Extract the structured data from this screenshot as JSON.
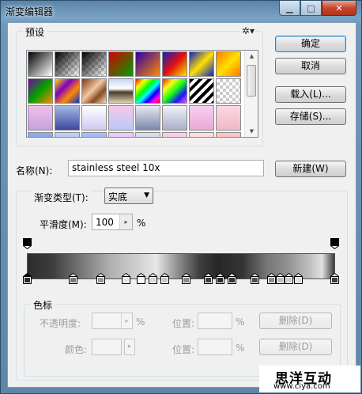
{
  "window": {
    "title": "渐变编辑器",
    "min_glyph": "▁",
    "max_glyph": "□",
    "close_glyph": "✕"
  },
  "presets": {
    "label": "预设",
    "gear_glyph": "✲▾",
    "scroll_up_glyph": "▲",
    "scroll_down_glyph": "▼",
    "swatches": [
      {
        "name": "black-white",
        "css": "linear-gradient(135deg,#000,#fff)"
      },
      {
        "name": "fg-transparent",
        "css": "linear-gradient(135deg,#000 0%,rgba(0,0,0,0) 100%), repeating-conic-gradient(#ccc 0 25%, #fff 0 50%) 0 0/8px 8px"
      },
      {
        "name": "black-transparent",
        "css": "linear-gradient(135deg,#000,rgba(0,0,0,0)), repeating-conic-gradient(#ccc 0 25%, #fff 0 50%) 0 0/8px 8px"
      },
      {
        "name": "red-green",
        "css": "linear-gradient(135deg,#d40000,#00a000)"
      },
      {
        "name": "violet-orange",
        "css": "linear-gradient(135deg,#2a00a8,#ff8a00)"
      },
      {
        "name": "blue-red-yellow",
        "css": "linear-gradient(135deg,#1020c0,#e01010 50%,#ffe000)"
      },
      {
        "name": "blue-yellow-blue",
        "css": "linear-gradient(135deg,#1020c0,#ffe000 50%,#1020c0)"
      },
      {
        "name": "orange-yellow-orange",
        "css": "linear-gradient(135deg,#ff7a00,#ffe000 50%,#ff7a00)"
      },
      {
        "name": "violet-green-orange",
        "css": "linear-gradient(135deg,#7a00a0,#00a000 50%,#ff8a00)"
      },
      {
        "name": "yellow-violet-orange-blue",
        "css": "linear-gradient(135deg,#ffe000,#8000c0 35%,#ff8a00 65%,#1030d0)"
      },
      {
        "name": "copper",
        "css": "linear-gradient(135deg,#7a3a1a,#f0c8a0 45%,#8a4a20 70%,#f6d8b8)"
      },
      {
        "name": "chrome",
        "css": "linear-gradient(180deg,#c8d8f0,#fff 40%,#4a3a2a 55%,#e0d0b0)"
      },
      {
        "name": "spectrum",
        "css": "linear-gradient(135deg,#f00,#ff0 20%,#0f0 40%,#0ff 55%,#00f 70%,#f0f 85%,#f00)"
      },
      {
        "name": "transparent-rainbow",
        "css": "linear-gradient(135deg,rgba(255,0,0,.9),rgba(255,255,0,.9) 25%,rgba(0,255,0,.9) 50%,rgba(0,0,255,.9) 75%,rgba(255,0,255,.6)), repeating-conic-gradient(#ccc 0 25%, #fff 0 50%) 0 0/8px 8px"
      },
      {
        "name": "transparent-stripes",
        "css": "repeating-linear-gradient(135deg,#000 0 4px,#fff 4px 8px)"
      },
      {
        "name": "transparent-checker",
        "css": "repeating-conic-gradient(#ccc 0 25%, #fff 0 50%) 0 0/8px 8px"
      },
      {
        "name": "pastel-violet",
        "css": "linear-gradient(180deg,#f0c0e8,#c8a0e0)"
      },
      {
        "name": "blue-steel",
        "css": "linear-gradient(180deg,#a8b8e0,#3848a0)"
      },
      {
        "name": "lavender",
        "css": "linear-gradient(180deg,#fff,#d0c8f0)"
      },
      {
        "name": "pink-blue",
        "css": "linear-gradient(180deg,#f8c8e8,#b8c8f8)"
      },
      {
        "name": "silver-steel",
        "css": "linear-gradient(180deg,#e8e8f0,#7888a8)"
      },
      {
        "name": "gray-steel",
        "css": "linear-gradient(180deg,#f0f0f8,#a8b0c8)"
      },
      {
        "name": "pink-pastel",
        "css": "linear-gradient(180deg,#f8d0f0,#e8a8d8)"
      },
      {
        "name": "rose-pastel",
        "css": "linear-gradient(180deg,#fcd8e0,#f0b8c8)"
      },
      {
        "name": "sky-blue",
        "css": "linear-gradient(180deg,#90b0f0,#5878d8)"
      },
      {
        "name": "pale-blue",
        "css": "linear-gradient(180deg,#c0d0f8,#98b0f0)"
      },
      {
        "name": "soft-blue",
        "css": "linear-gradient(180deg,#a8c0f8,#7898e8)"
      },
      {
        "name": "lilac",
        "css": "linear-gradient(180deg,#e8d0f8,#c8b0f0)"
      },
      {
        "name": "cool-gray",
        "css": "linear-gradient(180deg,#d8e0f0,#b8c0d8)"
      },
      {
        "name": "baby-pink",
        "css": "linear-gradient(180deg,#f8d0e8,#f0b8d8)"
      },
      {
        "name": "peach",
        "css": "linear-gradient(180deg,#fce0e0,#f8c8c8)"
      },
      {
        "name": "salmon",
        "css": "linear-gradient(180deg,#fcc8c8,#f0a8a8)"
      }
    ]
  },
  "buttons": {
    "ok": "确定",
    "cancel": "取消",
    "load": "载入(L)...",
    "save": "存储(S)...",
    "new": "新建(W)"
  },
  "name": {
    "label": "名称(N):",
    "value": "stainless steel 10x"
  },
  "gradient_type": {
    "label": "渐变类型(T):",
    "value": "实底",
    "caret_glyph": "▼"
  },
  "smoothness": {
    "label": "平滑度(M):",
    "value": "100",
    "unit": "%",
    "spin_glyph": "▸"
  },
  "gradient": {
    "opacity_stops": [
      "left",
      "right"
    ],
    "color_stops": [
      {
        "color": "#2c2c2c",
        "selected": true
      },
      {
        "color": "#7a7a7a"
      },
      {
        "color": "#9a9a9a"
      },
      {
        "color": "#e6e6e6"
      },
      {
        "color": "#ffffff"
      },
      {
        "color": "#d9d9d9"
      },
      {
        "color": "#c8c8c8"
      },
      {
        "color": "#8a8a8a"
      },
      {
        "color": "#3f3f3f"
      },
      {
        "color": "#2a2a2a"
      },
      {
        "color": "#343434"
      },
      {
        "color": "#505050"
      },
      {
        "color": "#8d8d8d"
      },
      {
        "color": "#bfbfbf"
      },
      {
        "color": "#d0d0d0"
      },
      {
        "color": "#e0e0e0"
      },
      {
        "color": "#3b3b3b"
      }
    ]
  },
  "color_stop_section": {
    "label": "色标",
    "opacity_label": "不透明度:",
    "opacity_unit": "%",
    "location_label": "位置:",
    "location_unit": "%",
    "delete_label": "删除(D)",
    "color_label": "颜色:",
    "color_location_label": "位置:",
    "color_location_unit": "%",
    "color_delete_label": "删除(D)",
    "spin_glyph": "▸"
  },
  "watermark": {
    "title": "思洋互动",
    "url": "www.ciya.com"
  }
}
